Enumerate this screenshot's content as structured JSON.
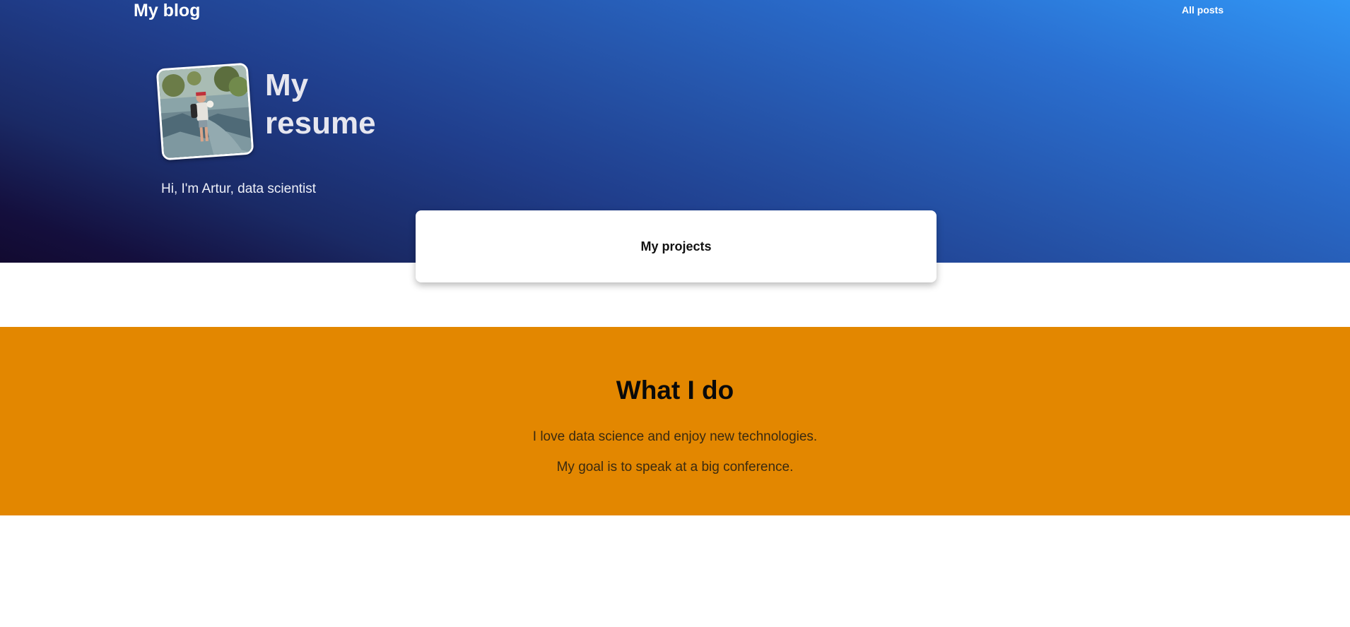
{
  "nav": {
    "title": "My blog",
    "all_posts": "All posts"
  },
  "hero": {
    "heading_line1": "My",
    "heading_line2": "resume",
    "intro": "Hi, I'm Artur, data scientist",
    "avatar_icon": "profile-photo"
  },
  "projects": {
    "label": "My projects"
  },
  "what_i_do": {
    "heading": "What I do",
    "paragraphs": [
      "I love data science and enjoy new technologies.",
      "My goal is to speak at a big conference."
    ]
  },
  "colors": {
    "hero_gradient_top": "#3196f5",
    "hero_gradient_bottom": "#120a30",
    "section_orange": "#e38700",
    "card_background": "#ffffff"
  }
}
